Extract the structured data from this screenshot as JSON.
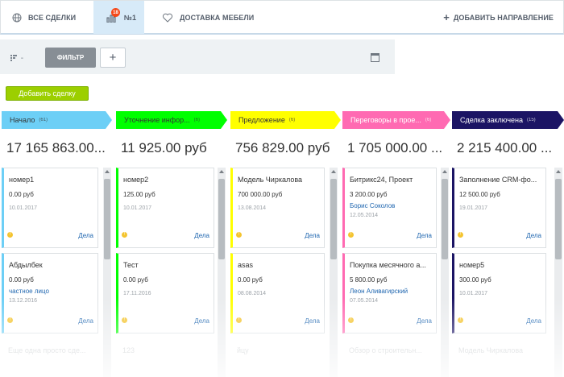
{
  "tabs": {
    "all_deals": "ВСЕ СДЕЛКИ",
    "active": "№1",
    "active_badge": "18",
    "furniture": "ДОСТАВКА МЕБЕЛИ",
    "add_direction": "ДОБАВИТЬ НАПРАВЛЕНИЕ"
  },
  "toolbar": {
    "view_label": "-",
    "filter": "ФИЛЬТР",
    "plus": "+"
  },
  "add_deal": "Добавить сделку",
  "columns": [
    {
      "title": "Начало",
      "count": "(61)",
      "sum": "17 165 863.00...",
      "color": "#6dcff6",
      "text_color": "#333333",
      "cards": [
        {
          "title": "номер1",
          "price": "0.00 руб",
          "contact": "",
          "date": "10.01.2017",
          "dela": "Дела"
        },
        {
          "title": "Абдылбек",
          "price": "0.00 руб",
          "contact": "частное лицо",
          "date": "13.12.2016",
          "dela": "Дела"
        }
      ],
      "ghost": "Еще одна просто сде..."
    },
    {
      "title": "Уточнение инфор...",
      "count": "(6)",
      "sum": "11 925.00 руб",
      "color": "#00ff00",
      "text_color": "#333333",
      "cards": [
        {
          "title": "номер2",
          "price": "125.00 руб",
          "contact": "",
          "date": "10.01.2017",
          "dela": "Дела"
        },
        {
          "title": "Тест",
          "price": "0.00 руб",
          "contact": "",
          "date": "17.11.2016",
          "dela": "Дела"
        }
      ],
      "ghost": "123"
    },
    {
      "title": "Предложение",
      "count": "(6)",
      "sum": "756 829.00 руб",
      "color": "#ffff00",
      "text_color": "#333333",
      "cards": [
        {
          "title": "Модель Чиркалова",
          "price": "700 000.00 руб",
          "contact": "",
          "date": "13.08.2014",
          "dela": "Дела"
        },
        {
          "title": "asas",
          "price": "0.00 руб",
          "contact": "",
          "date": "08.08.2014",
          "dela": "Дела"
        }
      ],
      "ghost": "йцу"
    },
    {
      "title": "Переговоры в прое...",
      "count": "(6)",
      "sum": "1 705 000.00 ...",
      "color": "#ff6ab2",
      "text_color": "#ffffff",
      "cards": [
        {
          "title": "Битрикс24, Проект",
          "price": "3 200.00 руб",
          "contact": "Борис Соколов",
          "date": "12.05.2014",
          "dela": "Дела"
        },
        {
          "title": "Покупка месячного а...",
          "price": "5 800.00 руб",
          "contact": "Леон Аливагирский",
          "date": "07.05.2014",
          "dela": "Дела"
        }
      ],
      "ghost": "Обзор о строительн..."
    },
    {
      "title": "Сделка заключена",
      "count": "(15)",
      "sum": "2 215 400.00 ...",
      "color": "#1b1464",
      "text_color": "#ffffff",
      "cards": [
        {
          "title": "Заполнение CRM-фо...",
          "price": "12 500.00 руб",
          "contact": "",
          "date": "19.01.2017",
          "dela": "Дела"
        },
        {
          "title": "номер5",
          "price": "300.00 руб",
          "contact": "",
          "date": "10.01.2017",
          "dela": "Дела"
        }
      ],
      "ghost": "Модель Чиркалова"
    }
  ]
}
